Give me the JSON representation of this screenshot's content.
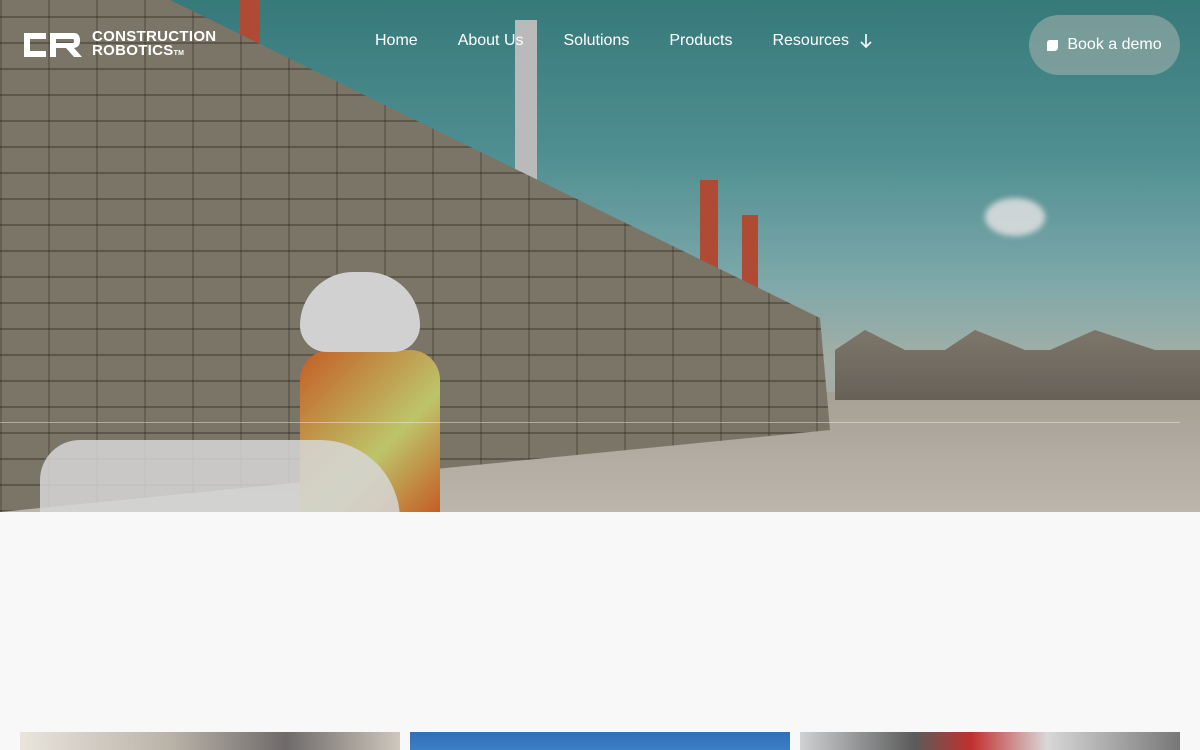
{
  "brand": {
    "line1": "CONSTRUCTION",
    "line2": "ROBOTICS",
    "trademark": "TM",
    "color": "#ffffff"
  },
  "nav": {
    "items": [
      {
        "label": "Home"
      },
      {
        "label": "About Us"
      },
      {
        "label": "Solutions"
      },
      {
        "label": "Products"
      },
      {
        "label": "Resources",
        "icon": "arrow-down-icon"
      }
    ]
  },
  "cta": {
    "label": "Book a demo",
    "icon": "chat-bubble-icon"
  },
  "colors": {
    "page_background": "#f8f8f8",
    "nav_text": "#ffffff",
    "cta_background": "rgba(170,180,175,0.55)"
  }
}
